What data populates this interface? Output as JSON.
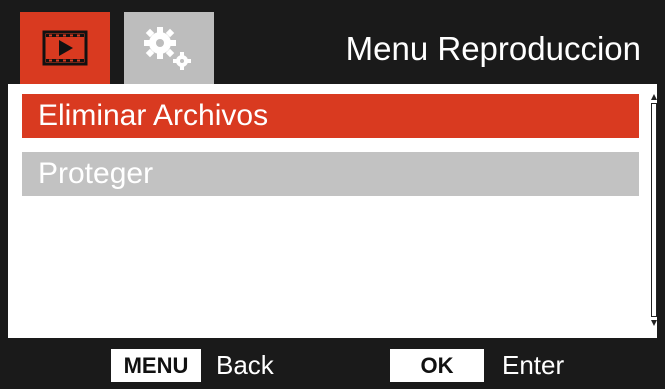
{
  "header": {
    "tabs": [
      {
        "icon": "playback-icon",
        "active": true
      },
      {
        "icon": "settings-gears-icon",
        "active": false
      }
    ],
    "title": "Menu Reproduccion"
  },
  "menu": {
    "items": [
      {
        "label": "Eliminar Archivos",
        "selected": true
      },
      {
        "label": "Proteger",
        "selected": false
      }
    ]
  },
  "footer": {
    "menu_key": "MENU",
    "menu_action": "Back",
    "ok_key": "OK",
    "ok_action": "Enter"
  },
  "colors": {
    "accent": "#d93a20",
    "background": "#1a1a1a",
    "panel": "#ffffff",
    "inactive_item": "#c2c2c2"
  }
}
